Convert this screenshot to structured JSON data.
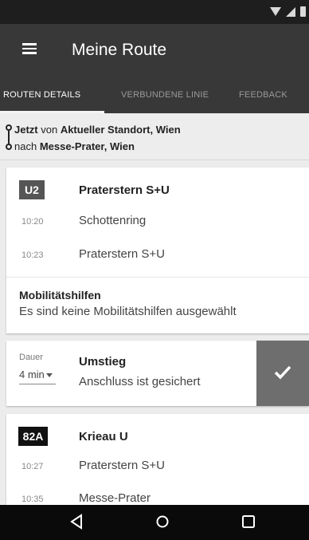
{
  "app": {
    "title": "Meine Route"
  },
  "tabs": [
    {
      "label": "ROUTEN DETAILS",
      "active": true
    },
    {
      "label": "VERBUNDENE LINIE",
      "active": false
    },
    {
      "label": "FEEDBACK",
      "active": false
    }
  ],
  "summary": {
    "from_prefix": "Jetzt",
    "from_word": " von ",
    "from_place": "Aktueller Standort, Wien",
    "to_word": "nach ",
    "to_place": "Messe-Prater, Wien"
  },
  "legs": [
    {
      "line": "U2",
      "direction": "Praterstern S+U",
      "stops": [
        {
          "time": "10:20",
          "name": "Schottenring"
        },
        {
          "time": "10:23",
          "name": "Praterstern S+U"
        }
      ]
    },
    {
      "line": "82A",
      "direction": "Krieau U",
      "stops": [
        {
          "time": "10:27",
          "name": "Praterstern S+U"
        },
        {
          "time": "10:35",
          "name": "Messe-Prater"
        }
      ]
    }
  ],
  "mobility": {
    "title": "Mobilitätshilfen",
    "text": "Es sind keine Mobilitätshilfen ausgewählt"
  },
  "transfer": {
    "duration_label": "Dauer",
    "duration_value": "4 min",
    "title": "Umstieg",
    "text": "Anschluss ist gesichert"
  },
  "icons": {
    "menu": "menu-icon",
    "route": "route-icon",
    "check": "check-icon",
    "back": "back-icon",
    "home": "home-icon",
    "recents": "recents-icon"
  },
  "colors": {
    "app_bar": "#383838",
    "status_bar": "#1e1e1e",
    "badge_u2": "#555555",
    "badge_82a": "#111111",
    "confirm": "#6e6e6e"
  }
}
